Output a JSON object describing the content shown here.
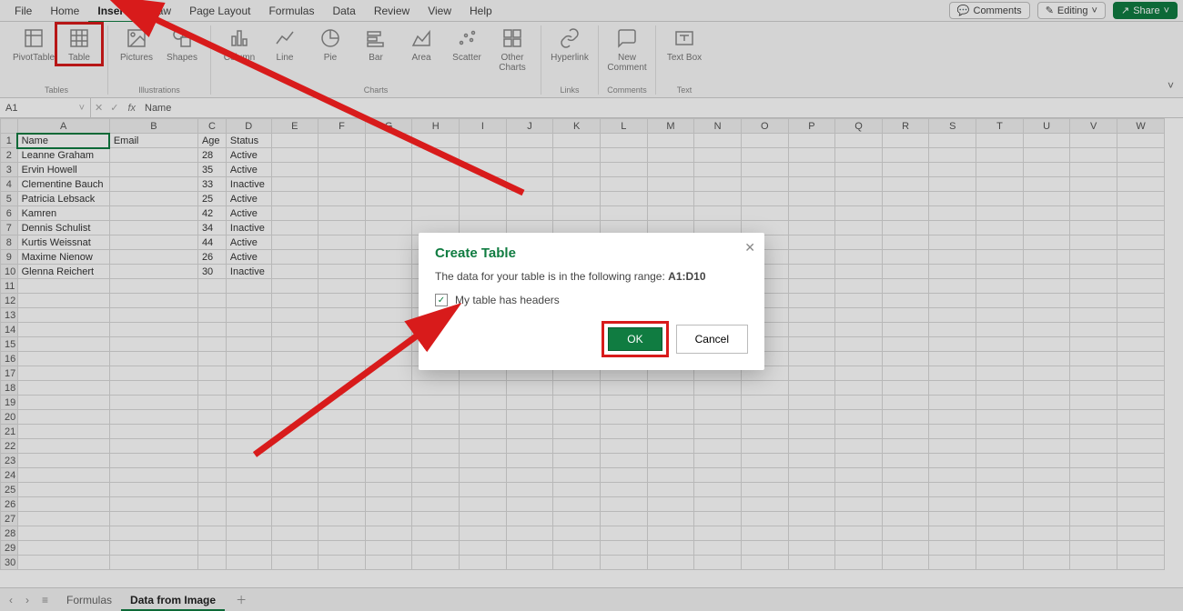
{
  "menu": {
    "tabs": [
      "File",
      "Home",
      "Insert",
      "Draw",
      "Page Layout",
      "Formulas",
      "Data",
      "Review",
      "View",
      "Help"
    ],
    "active": "Insert",
    "comments": "Comments",
    "editing": "Editing",
    "share": "Share"
  },
  "ribbon": {
    "groups": [
      {
        "label": "Tables",
        "items": [
          {
            "name": "pivottable",
            "label": "PivotTable"
          },
          {
            "name": "table",
            "label": "Table",
            "highlight": true
          }
        ]
      },
      {
        "label": "Illustrations",
        "items": [
          {
            "name": "pictures",
            "label": "Pictures"
          },
          {
            "name": "shapes",
            "label": "Shapes"
          }
        ]
      },
      {
        "label": "Charts",
        "items": [
          {
            "name": "column",
            "label": "Column"
          },
          {
            "name": "line",
            "label": "Line"
          },
          {
            "name": "pie",
            "label": "Pie"
          },
          {
            "name": "bar",
            "label": "Bar"
          },
          {
            "name": "area",
            "label": "Area"
          },
          {
            "name": "scatter",
            "label": "Scatter"
          },
          {
            "name": "other",
            "label": "Other Charts"
          }
        ]
      },
      {
        "label": "Links",
        "items": [
          {
            "name": "hyperlink",
            "label": "Hyperlink"
          }
        ]
      },
      {
        "label": "Comments",
        "items": [
          {
            "name": "newcomment",
            "label": "New Comment"
          }
        ]
      },
      {
        "label": "Text",
        "items": [
          {
            "name": "textbox",
            "label": "Text Box"
          }
        ]
      }
    ]
  },
  "formula_bar": {
    "name_box": "A1",
    "fx_label": "fx",
    "value": "Name"
  },
  "columns": [
    "A",
    "B",
    "C",
    "D",
    "E",
    "F",
    "G",
    "H",
    "I",
    "J",
    "K",
    "L",
    "M",
    "N",
    "O",
    "P",
    "Q",
    "R",
    "S",
    "T",
    "U",
    "V",
    "W"
  ],
  "headers": [
    "Name",
    "Email",
    "Age",
    "Status"
  ],
  "rows": [
    [
      "Leanne Graham",
      "",
      "28",
      "Active"
    ],
    [
      "Ervin Howell",
      "",
      "35",
      "Active"
    ],
    [
      "Clementine Bauch",
      "",
      "33",
      "Inactive"
    ],
    [
      "Patricia Lebsack",
      "",
      "25",
      "Active"
    ],
    [
      "Kamren",
      "",
      "42",
      "Active"
    ],
    [
      "Dennis Schulist",
      "",
      "34",
      "Inactive"
    ],
    [
      "Kurtis Weissnat",
      "",
      "44",
      "Active"
    ],
    [
      "Maxime Nienow",
      "",
      "26",
      "Active"
    ],
    [
      "Glenna Reichert",
      "",
      "30",
      "Inactive"
    ]
  ],
  "total_rows": 30,
  "sheets": {
    "tabs": [
      "Formulas",
      "Data from Image"
    ],
    "active": "Data from Image"
  },
  "dialog": {
    "title": "Create Table",
    "body_prefix": "The data for your table is in the following range: ",
    "range": "A1:D10",
    "checkbox": "My table has headers",
    "checked": true,
    "ok": "OK",
    "cancel": "Cancel"
  }
}
